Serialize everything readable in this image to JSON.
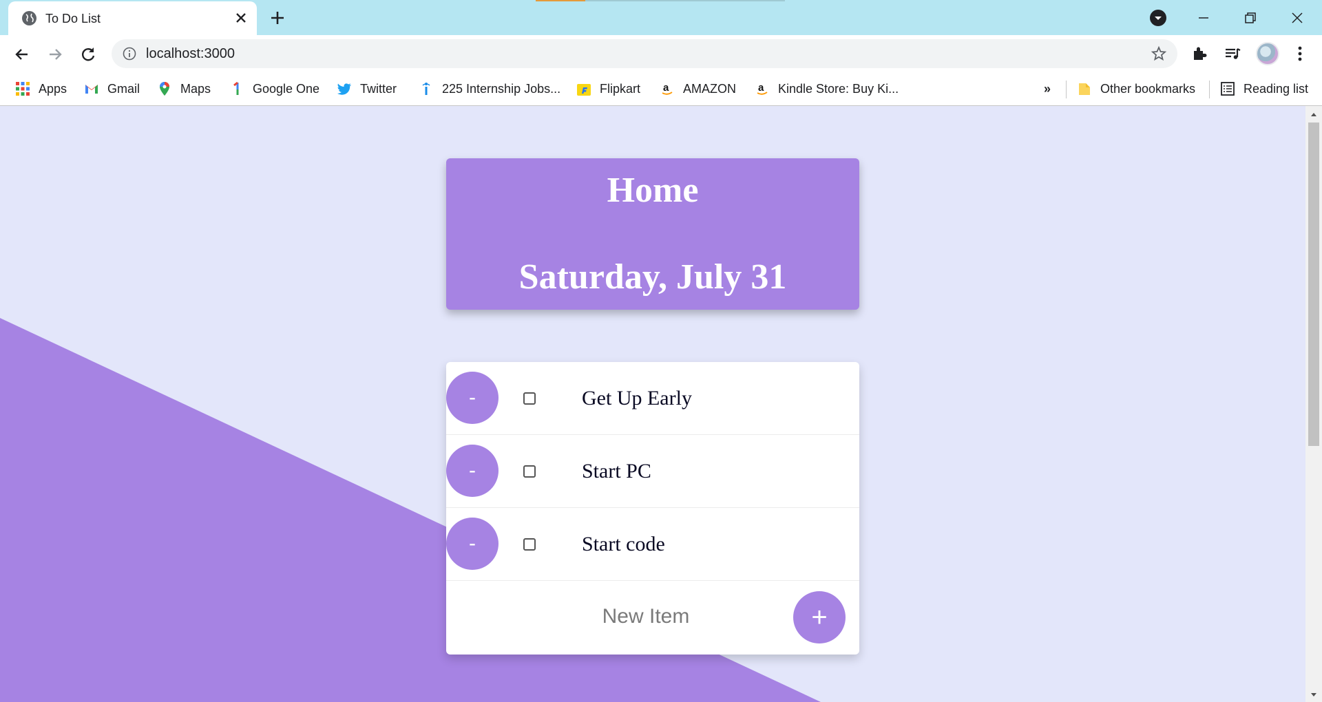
{
  "browser": {
    "tab_title": "To Do List",
    "url": "localhost:3000",
    "bookmarks": [
      {
        "label": "Apps",
        "icon": "apps-grid-icon"
      },
      {
        "label": "Gmail",
        "icon": "gmail-icon"
      },
      {
        "label": "Maps",
        "icon": "maps-pin-icon"
      },
      {
        "label": "Google One",
        "icon": "google-one-icon"
      },
      {
        "label": "Twitter",
        "icon": "twitter-bird-icon"
      },
      {
        "label": "225 Internship Jobs...",
        "icon": "internshala-icon"
      },
      {
        "label": "Flipkart",
        "icon": "flipkart-icon"
      },
      {
        "label": "AMAZON",
        "icon": "amazon-icon"
      },
      {
        "label": "Kindle Store: Buy Ki...",
        "icon": "amazon-icon"
      }
    ],
    "overflow_label": "»",
    "other_bookmarks": "Other bookmarks",
    "reading_list": "Reading list"
  },
  "page": {
    "list_title": "Home",
    "date": "Saturday, July 31",
    "items": [
      {
        "text": "Get Up Early",
        "checked": false,
        "delete_label": "-"
      },
      {
        "text": "Start PC",
        "checked": false,
        "delete_label": "-"
      },
      {
        "text": "Start code",
        "checked": false,
        "delete_label": "-"
      }
    ],
    "new_item_placeholder": "New Item",
    "add_label": "+"
  },
  "colors": {
    "accent": "#A683E3",
    "background": "#E3E6FA",
    "tabstrip": "#B5E6F2"
  }
}
